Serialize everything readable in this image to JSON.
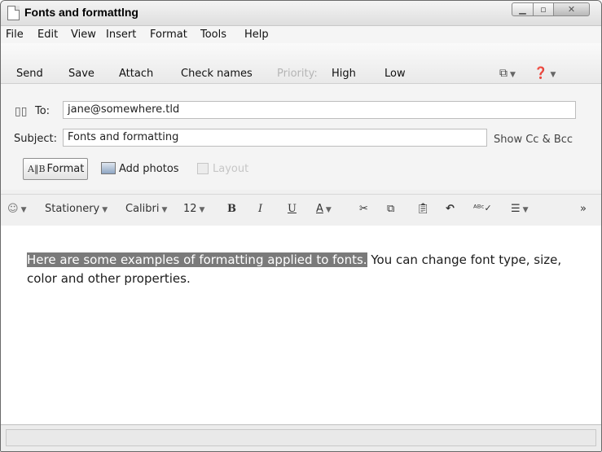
{
  "window": {
    "title": "Fonts and formattlng"
  },
  "menu": [
    "File",
    "Edit",
    "View",
    "Insert",
    "Format",
    "Tools",
    "Help"
  ],
  "toolbar": {
    "send": "Send",
    "save": "Save",
    "attach": "Attach",
    "check_names": "Check names",
    "priority": "Priority:",
    "high": "High",
    "low": "Low"
  },
  "header": {
    "to_label": "To:",
    "to_value": "jane@somewhere.tld",
    "subject_label": "Subject:",
    "subject_value": "Fonts and formatting",
    "show_cc_bcc": "Show Cc & Bcc",
    "format": "Format",
    "add_photos": "Add photos",
    "layout": "Layout"
  },
  "formatbar": {
    "stationery": "Stationery",
    "font": "Calibri",
    "size": "12",
    "bold": "B",
    "italic": "I",
    "underline": "U",
    "font_color": "A",
    "more": "»"
  },
  "message": {
    "selected_text": "Here are some examples of formatting applied to fonts.",
    "rest_text": " You can change font type, size, color and other properties."
  },
  "icons": [
    "document-icon",
    "minimize-icon",
    "maximize-icon",
    "close-icon",
    "read-options-icon",
    "help-icon",
    "address-book-icon",
    "format-icon",
    "add-photos-icon",
    "layout-icon",
    "emoticon-icon",
    "cut-icon",
    "copy-icon",
    "paste-icon",
    "undo-icon",
    "spell-check-icon",
    "list-icon"
  ]
}
